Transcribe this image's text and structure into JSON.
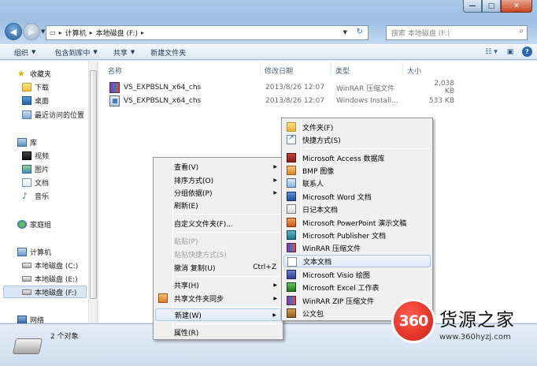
{
  "window": {
    "caption_buttons": {
      "minimize": "—",
      "maximize": "□",
      "close": "✕"
    }
  },
  "address": {
    "path": [
      "计算机",
      "本地磁盘 (F:)"
    ],
    "search_placeholder": "搜索 本地磁盘 (F:)"
  },
  "toolbar": {
    "organize": "组织",
    "include_in_library": "包含到库中",
    "share": "共享",
    "new_folder": "新建文件夹"
  },
  "nav": {
    "favorites": "收藏夹",
    "downloads": "下载",
    "desktop": "桌面",
    "recent": "最近访问的位置",
    "libraries": "库",
    "videos": "视频",
    "pictures": "图片",
    "documents": "文档",
    "music": "音乐",
    "homegroup": "家庭组",
    "computer": "计算机",
    "drive_c": "本地磁盘 (C:)",
    "drive_e": "本地磁盘 (E:)",
    "drive_f": "本地磁盘 (F:)",
    "network": "网络"
  },
  "columns": {
    "name": "名称",
    "date": "修改日期",
    "type": "类型",
    "size": "大小"
  },
  "files": [
    {
      "name": "VS_EXPBSLN_x64_chs",
      "date": "2013/8/26 12:07",
      "type": "WinRAR 压缩文件",
      "size": "2,038 KB",
      "icon": "winrar-icon"
    },
    {
      "name": "VS_EXPBSLN_x64_chs",
      "date": "2013/8/26 12:07",
      "type": "Windows Install...",
      "size": "533 KB",
      "icon": "installer-icon"
    }
  ],
  "status": {
    "count": "2 个对象"
  },
  "context_menu": {
    "view": "查看(V)",
    "sort": "排序方式(O)",
    "group": "分组依据(P)",
    "refresh": "刷新(E)",
    "customize": "自定义文件夹(F)...",
    "paste": "粘贴(P)",
    "paste_shortcut": "粘贴快捷方式(S)",
    "undo": "撤消 复制(U)",
    "undo_shortcut": "Ctrl+Z",
    "share_with": "共享(H)",
    "shared_folder_sync": "共享文件夹同步",
    "new": "新建(W)",
    "properties": "属性(R)"
  },
  "new_submenu": {
    "folder": "文件夹(F)",
    "shortcut": "快捷方式(S)",
    "access": "Microsoft Access 数据库",
    "bmp": "BMP 图像",
    "contact": "联系人",
    "word": "Microsoft Word 文档",
    "journal": "日记本文档",
    "powerpoint": "Microsoft PowerPoint 演示文稿",
    "publisher": "Microsoft Publisher 文档",
    "winrar": "WinRAR 压缩文件",
    "text": "文本文档",
    "visio": "Microsoft Visio 绘图",
    "excel": "Microsoft Excel 工作表",
    "winrar_zip": "WinRAR ZIP 压缩文件",
    "briefcase": "公文包"
  },
  "watermark": {
    "logo": "360",
    "title": "货源之家",
    "url": "www.360hyzj.com"
  }
}
